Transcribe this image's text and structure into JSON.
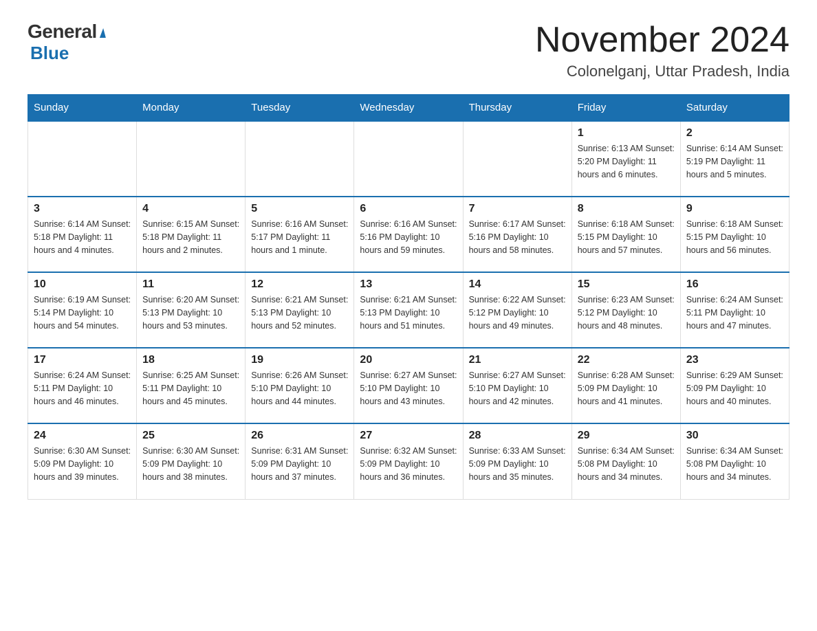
{
  "header": {
    "logo_general": "General",
    "logo_blue": "Blue",
    "month_title": "November 2024",
    "location": "Colonelganj, Uttar Pradesh, India"
  },
  "weekdays": [
    "Sunday",
    "Monday",
    "Tuesday",
    "Wednesday",
    "Thursday",
    "Friday",
    "Saturday"
  ],
  "weeks": [
    [
      {
        "day": "",
        "info": ""
      },
      {
        "day": "",
        "info": ""
      },
      {
        "day": "",
        "info": ""
      },
      {
        "day": "",
        "info": ""
      },
      {
        "day": "",
        "info": ""
      },
      {
        "day": "1",
        "info": "Sunrise: 6:13 AM\nSunset: 5:20 PM\nDaylight: 11 hours and 6 minutes."
      },
      {
        "day": "2",
        "info": "Sunrise: 6:14 AM\nSunset: 5:19 PM\nDaylight: 11 hours and 5 minutes."
      }
    ],
    [
      {
        "day": "3",
        "info": "Sunrise: 6:14 AM\nSunset: 5:18 PM\nDaylight: 11 hours and 4 minutes."
      },
      {
        "day": "4",
        "info": "Sunrise: 6:15 AM\nSunset: 5:18 PM\nDaylight: 11 hours and 2 minutes."
      },
      {
        "day": "5",
        "info": "Sunrise: 6:16 AM\nSunset: 5:17 PM\nDaylight: 11 hours and 1 minute."
      },
      {
        "day": "6",
        "info": "Sunrise: 6:16 AM\nSunset: 5:16 PM\nDaylight: 10 hours and 59 minutes."
      },
      {
        "day": "7",
        "info": "Sunrise: 6:17 AM\nSunset: 5:16 PM\nDaylight: 10 hours and 58 minutes."
      },
      {
        "day": "8",
        "info": "Sunrise: 6:18 AM\nSunset: 5:15 PM\nDaylight: 10 hours and 57 minutes."
      },
      {
        "day": "9",
        "info": "Sunrise: 6:18 AM\nSunset: 5:15 PM\nDaylight: 10 hours and 56 minutes."
      }
    ],
    [
      {
        "day": "10",
        "info": "Sunrise: 6:19 AM\nSunset: 5:14 PM\nDaylight: 10 hours and 54 minutes."
      },
      {
        "day": "11",
        "info": "Sunrise: 6:20 AM\nSunset: 5:13 PM\nDaylight: 10 hours and 53 minutes."
      },
      {
        "day": "12",
        "info": "Sunrise: 6:21 AM\nSunset: 5:13 PM\nDaylight: 10 hours and 52 minutes."
      },
      {
        "day": "13",
        "info": "Sunrise: 6:21 AM\nSunset: 5:13 PM\nDaylight: 10 hours and 51 minutes."
      },
      {
        "day": "14",
        "info": "Sunrise: 6:22 AM\nSunset: 5:12 PM\nDaylight: 10 hours and 49 minutes."
      },
      {
        "day": "15",
        "info": "Sunrise: 6:23 AM\nSunset: 5:12 PM\nDaylight: 10 hours and 48 minutes."
      },
      {
        "day": "16",
        "info": "Sunrise: 6:24 AM\nSunset: 5:11 PM\nDaylight: 10 hours and 47 minutes."
      }
    ],
    [
      {
        "day": "17",
        "info": "Sunrise: 6:24 AM\nSunset: 5:11 PM\nDaylight: 10 hours and 46 minutes."
      },
      {
        "day": "18",
        "info": "Sunrise: 6:25 AM\nSunset: 5:11 PM\nDaylight: 10 hours and 45 minutes."
      },
      {
        "day": "19",
        "info": "Sunrise: 6:26 AM\nSunset: 5:10 PM\nDaylight: 10 hours and 44 minutes."
      },
      {
        "day": "20",
        "info": "Sunrise: 6:27 AM\nSunset: 5:10 PM\nDaylight: 10 hours and 43 minutes."
      },
      {
        "day": "21",
        "info": "Sunrise: 6:27 AM\nSunset: 5:10 PM\nDaylight: 10 hours and 42 minutes."
      },
      {
        "day": "22",
        "info": "Sunrise: 6:28 AM\nSunset: 5:09 PM\nDaylight: 10 hours and 41 minutes."
      },
      {
        "day": "23",
        "info": "Sunrise: 6:29 AM\nSunset: 5:09 PM\nDaylight: 10 hours and 40 minutes."
      }
    ],
    [
      {
        "day": "24",
        "info": "Sunrise: 6:30 AM\nSunset: 5:09 PM\nDaylight: 10 hours and 39 minutes."
      },
      {
        "day": "25",
        "info": "Sunrise: 6:30 AM\nSunset: 5:09 PM\nDaylight: 10 hours and 38 minutes."
      },
      {
        "day": "26",
        "info": "Sunrise: 6:31 AM\nSunset: 5:09 PM\nDaylight: 10 hours and 37 minutes."
      },
      {
        "day": "27",
        "info": "Sunrise: 6:32 AM\nSunset: 5:09 PM\nDaylight: 10 hours and 36 minutes."
      },
      {
        "day": "28",
        "info": "Sunrise: 6:33 AM\nSunset: 5:09 PM\nDaylight: 10 hours and 35 minutes."
      },
      {
        "day": "29",
        "info": "Sunrise: 6:34 AM\nSunset: 5:08 PM\nDaylight: 10 hours and 34 minutes."
      },
      {
        "day": "30",
        "info": "Sunrise: 6:34 AM\nSunset: 5:08 PM\nDaylight: 10 hours and 34 minutes."
      }
    ]
  ]
}
